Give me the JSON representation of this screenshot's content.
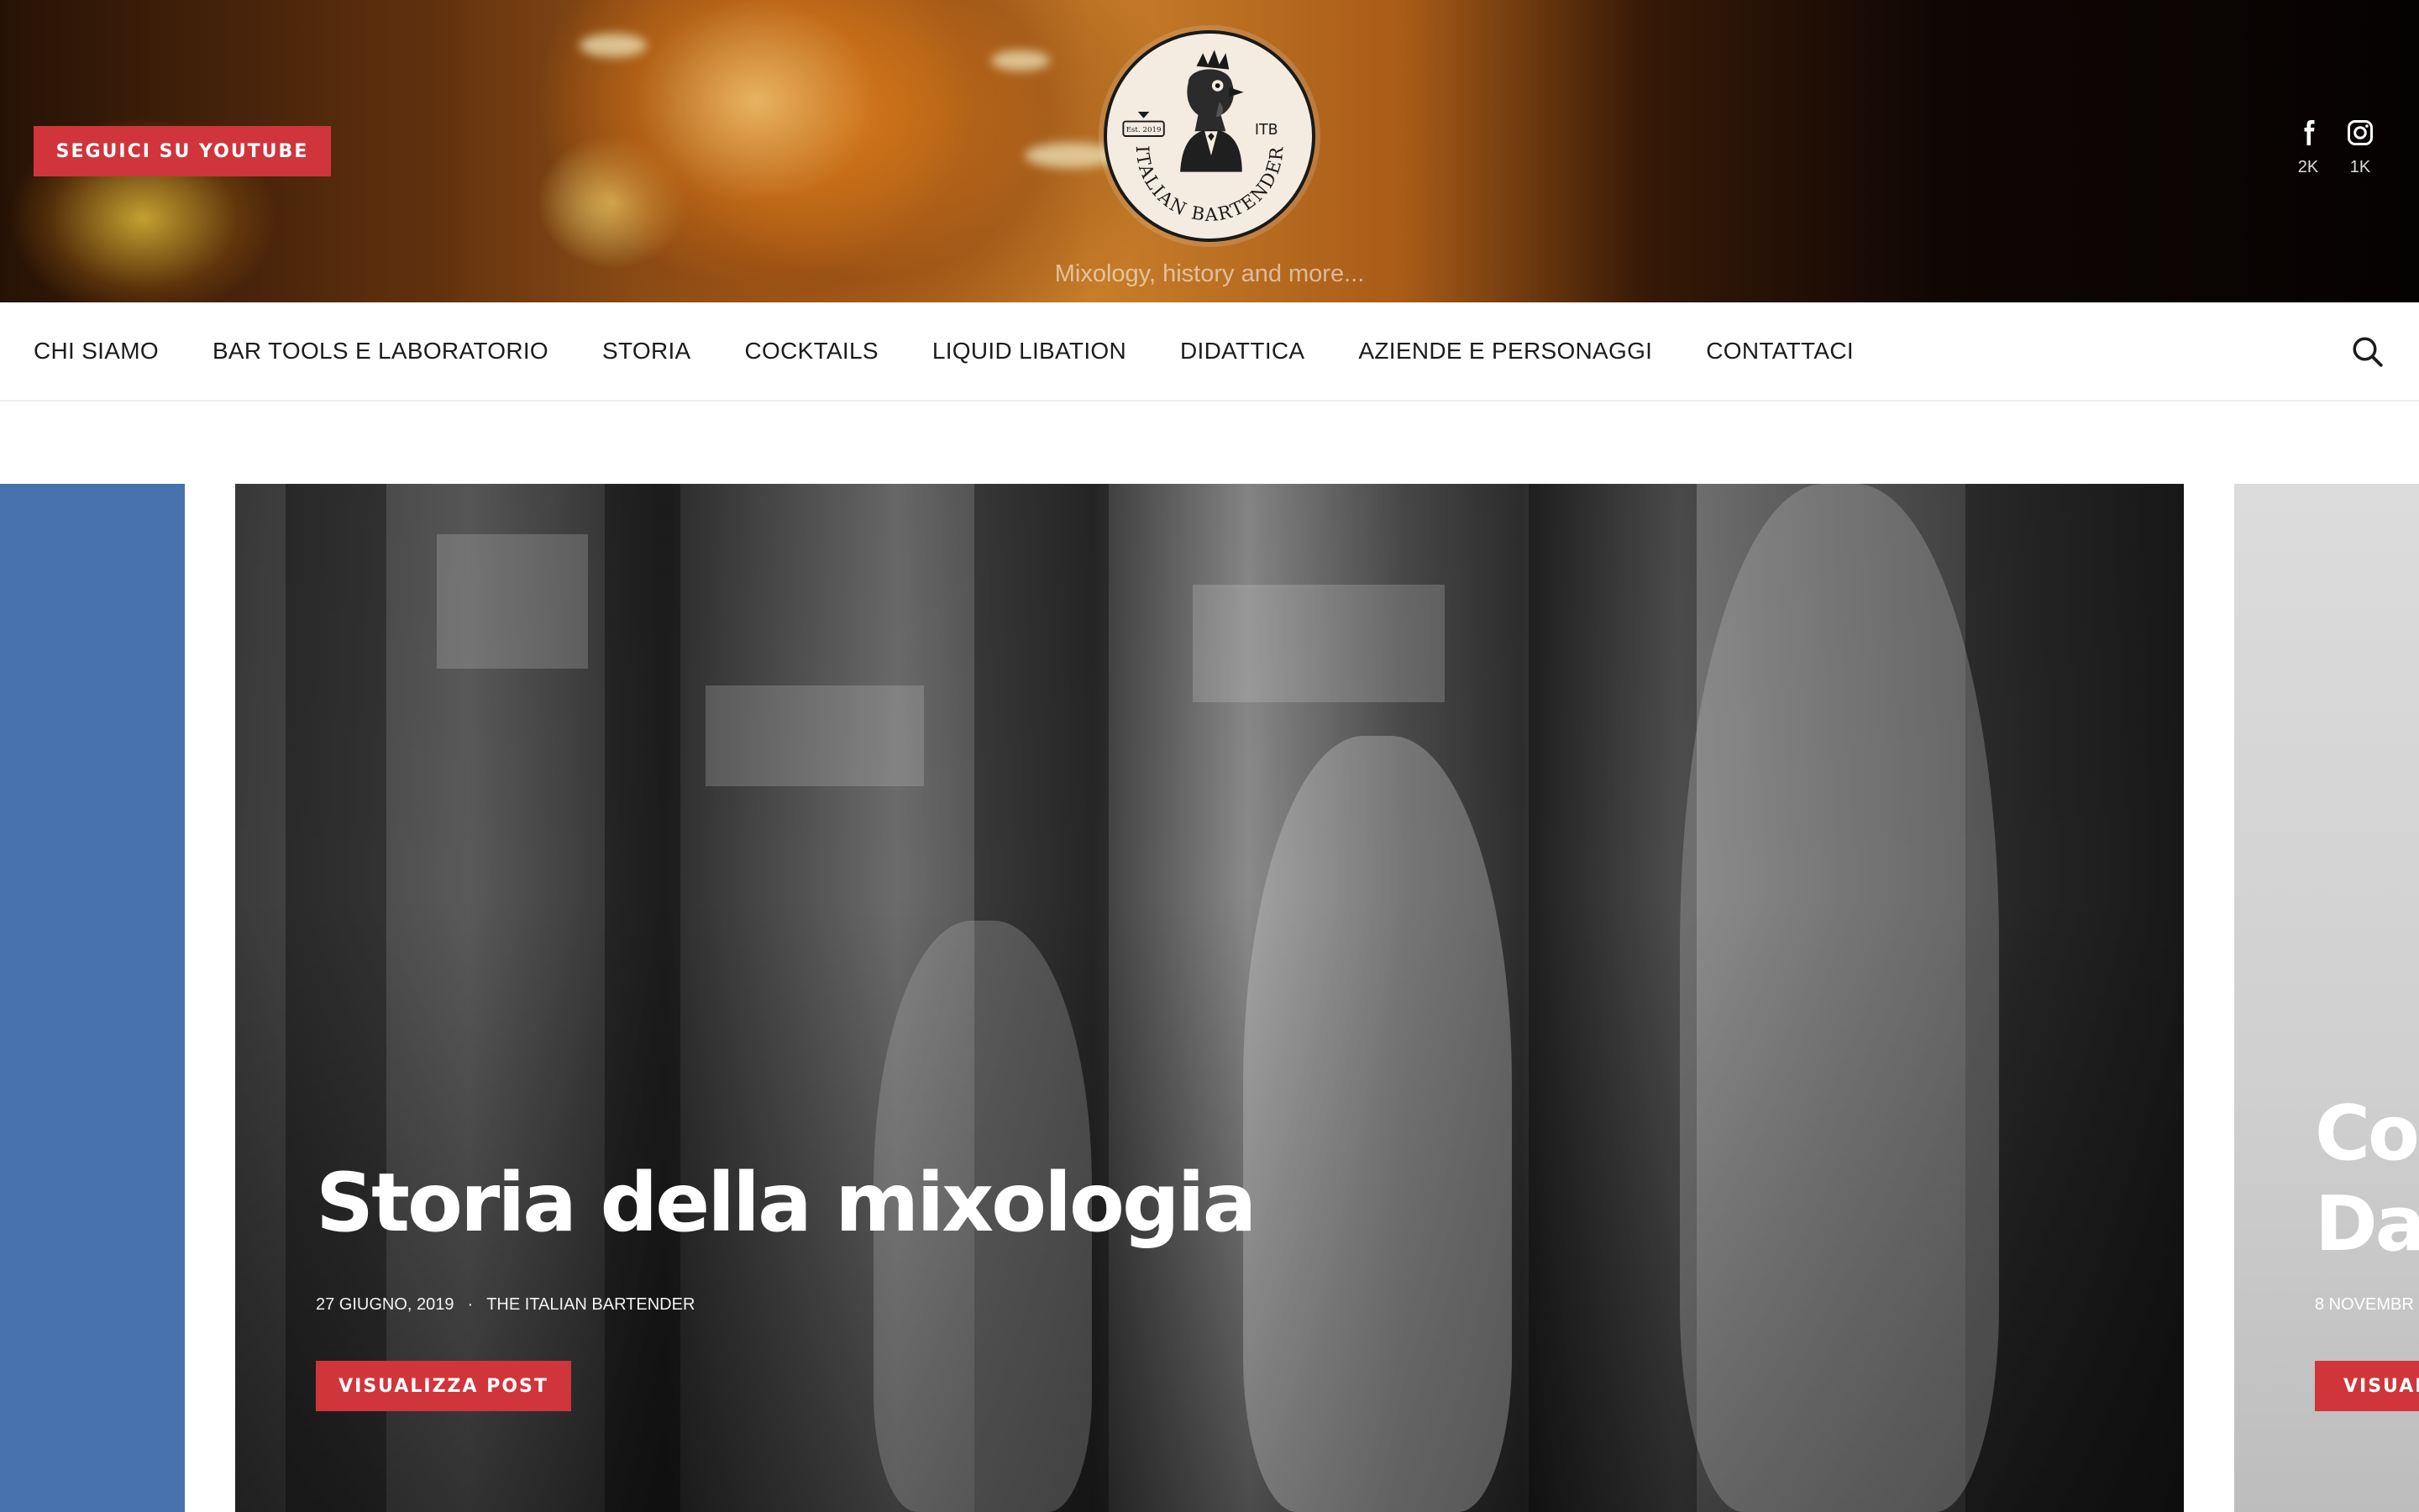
{
  "header": {
    "youtube_button": "SEGUICI SU YOUTUBE",
    "logo": {
      "name": "ITALIAN BARTENDER",
      "initials": "ITB",
      "est": "Est. 2019",
      "icon": "rooster-bartender-logo"
    },
    "tagline": "Mixology, history and more...",
    "social": [
      {
        "icon": "facebook-icon",
        "count": "2K"
      },
      {
        "icon": "instagram-icon",
        "count": "1K"
      }
    ]
  },
  "nav": {
    "items": [
      "CHI SIAMO",
      "BAR TOOLS E LABORATORIO",
      "STORIA",
      "COCKTAILS",
      "LIQUID LIBATION",
      "DIDATTICA",
      "AZIENDE E PERSONAGGI",
      "CONTATTACI"
    ],
    "search_icon": "search-icon"
  },
  "slider": {
    "current": {
      "title": "Storia della mixologia",
      "date": "27 GIUGNO, 2019",
      "author": "THE ITALIAN BARTENDER",
      "button": "VISUALIZZA POST"
    },
    "next": {
      "title_line1": "Co",
      "title_line2": "Da",
      "date": "8 NOVEMBR",
      "button": "VISUAL"
    }
  },
  "colors": {
    "accent": "#d0353b",
    "prev_slide": "#4772ad"
  }
}
